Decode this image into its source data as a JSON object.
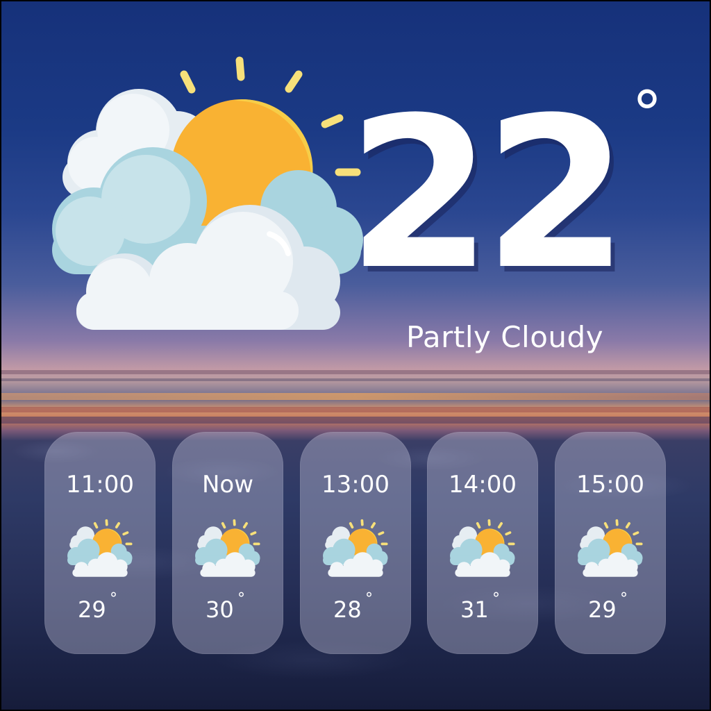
{
  "current": {
    "temperature": "22",
    "unit": "°",
    "condition": "Partly Cloudy",
    "icon": "partly-cloudy-icon"
  },
  "hourly": [
    {
      "time": "11:00",
      "temp": "29",
      "unit": "°",
      "icon": "partly-cloudy-icon"
    },
    {
      "time": "Now",
      "temp": "30",
      "unit": "°",
      "icon": "partly-cloudy-icon"
    },
    {
      "time": "13:00",
      "temp": "28",
      "unit": "°",
      "icon": "partly-cloudy-icon"
    },
    {
      "time": "14:00",
      "temp": "31",
      "unit": "°",
      "icon": "partly-cloudy-icon"
    },
    {
      "time": "15:00",
      "temp": "29",
      "unit": "°",
      "icon": "partly-cloudy-icon"
    }
  ],
  "colors": {
    "sky_top": "#16317a",
    "sun": "#f6b73c",
    "cloud_light": "#eef3f7",
    "cloud_blue": "#a9d4df",
    "sun_ray": "#f7e07a",
    "card_fill": "rgba(185,185,210,0.42)",
    "text": "#ffffff"
  }
}
